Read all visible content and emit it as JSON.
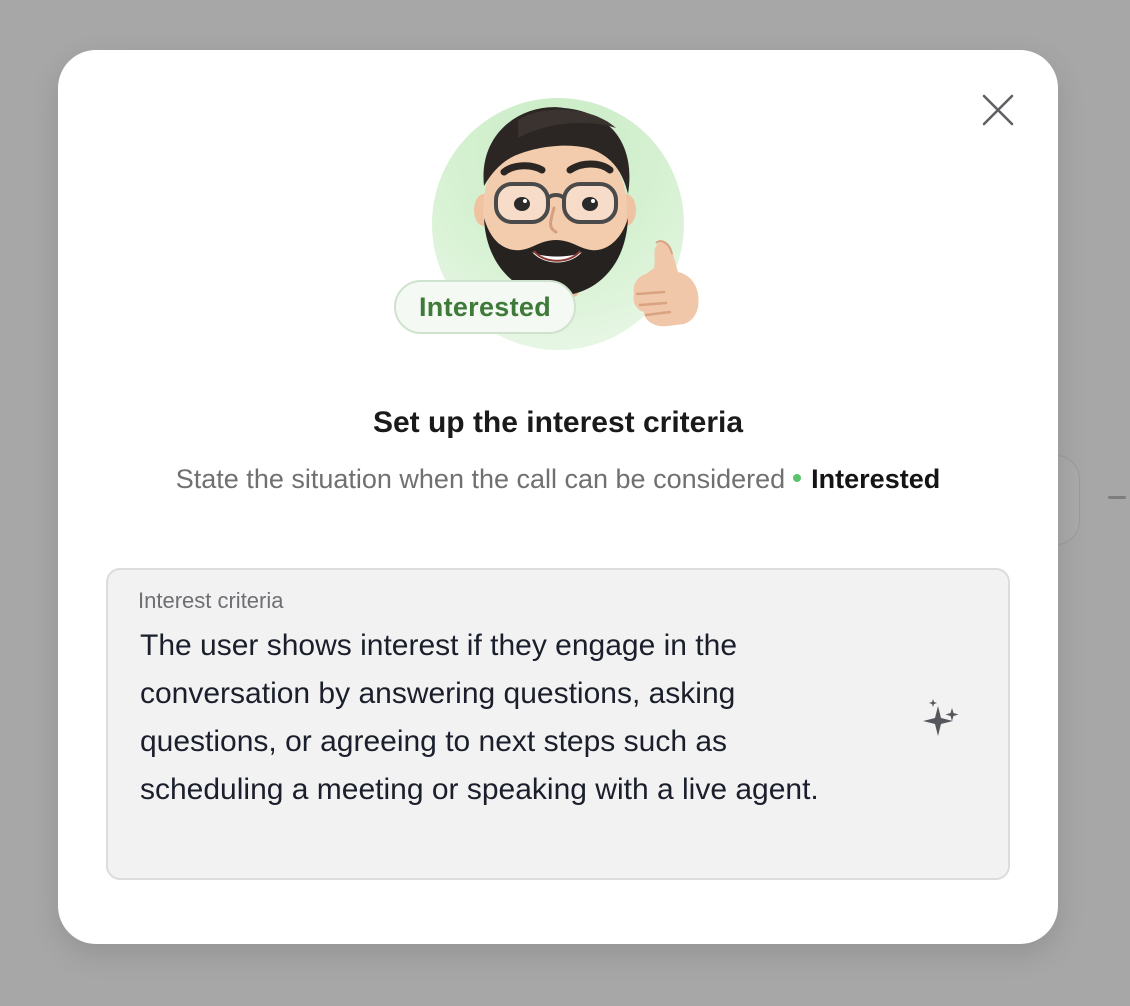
{
  "modal": {
    "status_badge": "Interested",
    "title": "Set up the interest criteria",
    "subtitle": {
      "text": "State the situation when the call can be considered",
      "highlight": "Interested",
      "dot_color": "#5cc36b"
    },
    "field": {
      "label": "Interest criteria",
      "value": "The user shows interest if they engage in the conversation by answering questions, asking questions, or agreeing to next steps such as scheduling a meeting or speaking with a live agent."
    },
    "icons": {
      "close": "close-icon",
      "ai_assist": "sparkle-icon",
      "avatar": "memoji-avatar"
    }
  },
  "colors": {
    "badge_text": "#3f7a3a",
    "badge_bg": "#f4faf3",
    "avatar_bg": "#d9f2d5"
  }
}
